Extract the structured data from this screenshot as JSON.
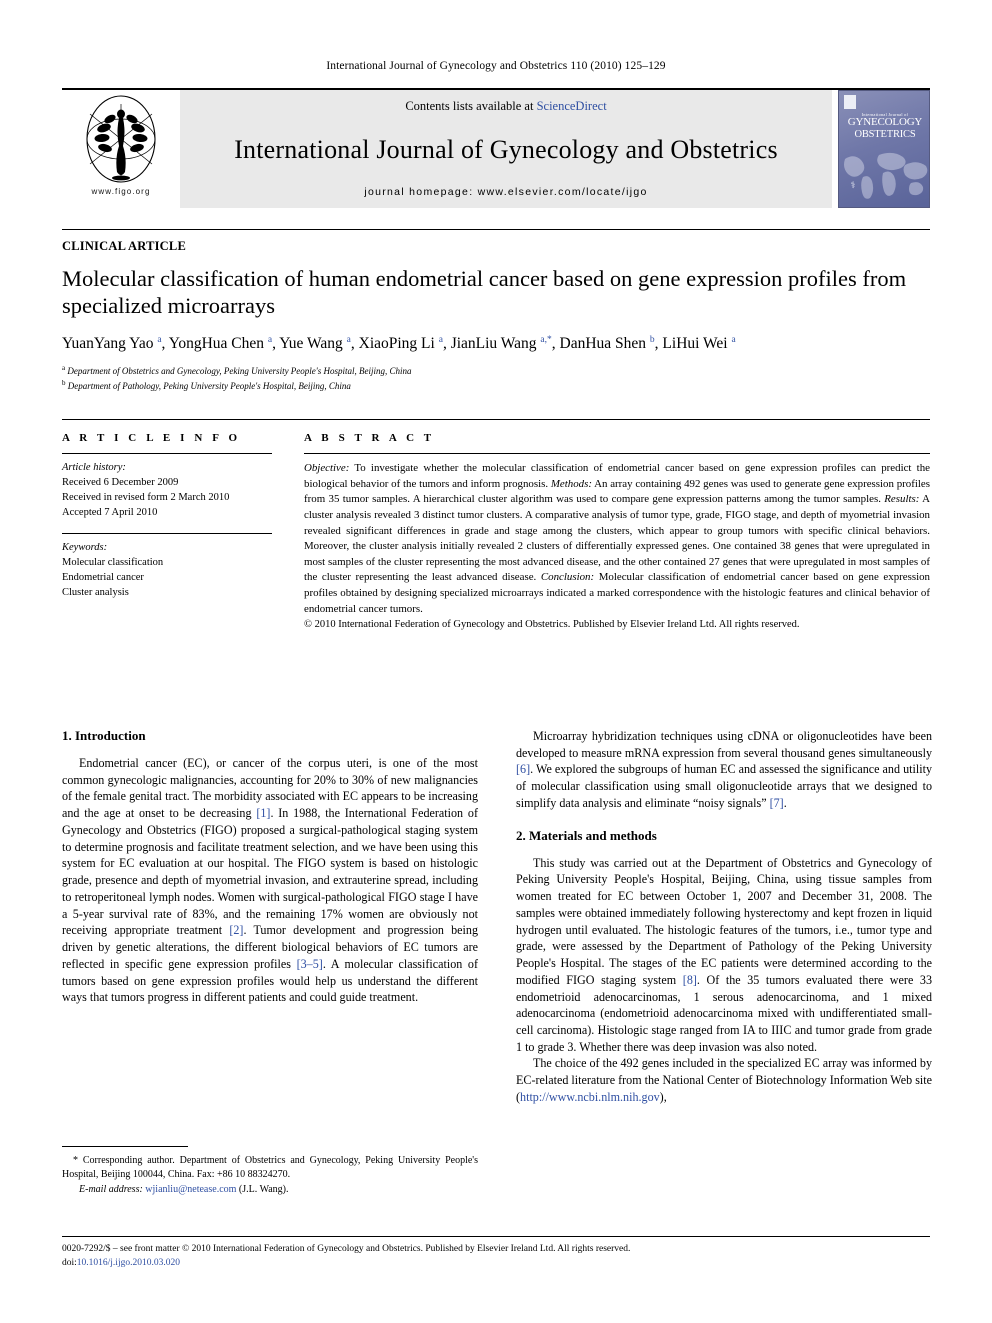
{
  "running_head": "International Journal of Gynecology and Obstetrics 110 (2010) 125–129",
  "masthead": {
    "figo_url": "www.figo.org",
    "contents_prefix": "Contents lists available at ",
    "contents_link": "ScienceDirect",
    "journal_title": "International Journal of Gynecology and Obstetrics",
    "homepage": "journal homepage: www.elsevier.com/locate/ijgo",
    "cover": {
      "line1": "International Journal of",
      "line2": "GYNECOLOGY",
      "line3": "OBSTETRICS"
    }
  },
  "article": {
    "type": "CLINICAL ARTICLE",
    "title": "Molecular classification of human endometrial cancer based on gene expression profiles from specialized microarrays",
    "authors": "YuanYang Yao a, YongHua Chen a, Yue Wang a, XiaoPing Li a, JianLiu Wang a,*, DanHua Shen b, LiHui Wei a",
    "affiliation_a": "Department of Obstetrics and Gynecology, Peking University People's Hospital, Beijing, China",
    "affiliation_b": "Department of Pathology, Peking University People's Hospital, Beijing, China"
  },
  "info": {
    "heading": "A R T I C L E    I N F O",
    "history_label": "Article history:",
    "history": [
      "Received 6 December 2009",
      "Received in revised form 2 March 2010",
      "Accepted 7 April 2010"
    ],
    "keywords_label": "Keywords:",
    "keywords": [
      "Molecular classification",
      "Endometrial cancer",
      "Cluster analysis"
    ]
  },
  "abstract": {
    "heading": "A B S T R A C T",
    "objective_label": "Objective:",
    "objective_text": " To investigate whether the molecular classification of endometrial cancer based on gene expression profiles can predict the biological behavior of the tumors and inform prognosis. ",
    "methods_label": "Methods:",
    "methods_text": " An array containing 492 genes was used to generate gene expression profiles from 35 tumor samples. A hierarchical cluster algorithm was used to compare gene expression patterns among the tumor samples. ",
    "results_label": "Results:",
    "results_text": " A cluster analysis revealed 3 distinct tumor clusters. A comparative analysis of tumor type, grade, FIGO stage, and depth of myometrial invasion revealed significant differences in grade and stage among the clusters, which appear to group tumors with specific clinical behaviors. Moreover, the cluster analysis initially revealed 2 clusters of differentially expressed genes. One contained 38 genes that were upregulated in most samples of the cluster representing the most advanced disease, and the other contained 27 genes that were upregulated in most samples of the cluster representing the least advanced disease. ",
    "conclusion_label": "Conclusion:",
    "conclusion_text": " Molecular classification of endometrial cancer based on gene expression profiles obtained by designing specialized microarrays indicated a marked correspondence with the histologic features and clinical behavior of endometrial cancer tumors.",
    "copyright": "© 2010 International Federation of Gynecology and Obstetrics. Published by Elsevier Ireland Ltd. All rights reserved."
  },
  "body": {
    "intro_heading": "1. Introduction",
    "intro_p1_a": "Endometrial cancer (EC), or cancer of the corpus uteri, is one of the most common gynecologic malignancies, accounting for 20% to 30% of new malignancies of the female genital tract. The morbidity associated with EC appears to be increasing and the age at onset to be decreasing ",
    "intro_p1_ref1": "[1]",
    "intro_p1_b": ". In 1988, the International Federation of Gynecology and Obstetrics (FIGO) proposed a surgical-pathological staging system to determine prognosis and facilitate treatment selection, and we have been using this system for EC evaluation at our hospital. The FIGO system is based on histologic grade, presence and depth of myometrial invasion, and extrauterine spread, including to retroperitoneal lymph nodes. Women with surgical-pathological FIGO stage I have a 5-year survival rate of 83%, and the remaining 17% women are obviously not receiving appropriate treatment ",
    "intro_p1_ref2": "[2]",
    "intro_p1_c": ". Tumor development and progression being driven by genetic alterations, the different biological behaviors of EC tumors are reflected in specific gene expression profiles ",
    "intro_p1_ref3": "[3–5]",
    "intro_p1_d": ". A molecular classification of tumors based on gene expression profiles would help us understand the different ways that tumors progress in different patients and could guide treatment.",
    "right_p1_a": "Microarray hybridization techniques using cDNA or oligonucleotides have been developed to measure mRNA expression from several thousand genes simultaneously ",
    "right_p1_ref6": "[6]",
    "right_p1_b": ". We explored the subgroups of human EC and assessed the significance and utility of molecular classification using small oligonucleotide arrays that we designed to simplify data analysis and eliminate “noisy signals” ",
    "right_p1_ref7": "[7]",
    "right_p1_c": ".",
    "methods_heading": "2. Materials and methods",
    "methods_p1_a": "This study was carried out at the Department of Obstetrics and Gynecology of Peking University People's Hospital, Beijing, China, using tissue samples from women treated for EC between October 1, 2007 and December 31, 2008. The samples were obtained immediately following hysterectomy and kept frozen in liquid hydrogen until evaluated. The histologic features of the tumors, i.e., tumor type and grade, were assessed by the Department of Pathology of the Peking University People's Hospital. The stages of the EC patients were determined according to the modified FIGO staging system ",
    "methods_p1_ref8": "[8]",
    "methods_p1_b": ". Of the 35 tumors evaluated there were 33 endometrioid adenocarcinomas, 1 serous adenocarcinoma, and 1 mixed adenocarcinoma (endometrioid adenocarcinoma mixed with undifferentiated small-cell carcinoma). Histologic stage ranged from IA to IIIC and tumor grade from grade 1 to grade 3. Whether there was deep invasion was also noted.",
    "methods_p2_a": "The choice of the 492 genes included in the specialized EC array was informed by EC-related literature from the National Center of Biotechnology Information Web site (",
    "methods_p2_link": "http://www.ncbi.nlm.nih.gov",
    "methods_p2_b": "),"
  },
  "footnote": {
    "star": "*",
    "text": " Corresponding author. Department of Obstetrics and Gynecology, Peking University People's Hospital, Beijing 100044, China. Fax: +86 10 88324270.",
    "email_label": "E-mail address:",
    "email": "wjianliu@netease.com",
    "email_owner": "(J.L. Wang)."
  },
  "publisher_footer": {
    "line1": "0020-7292/$ – see front matter © 2010 International Federation of Gynecology and Obstetrics. Published by Elsevier Ireland Ltd. All rights reserved.",
    "doi_label": "doi:",
    "doi": "10.1016/j.ijgo.2010.03.020"
  },
  "colors": {
    "link": "#2f4fa2",
    "masthead_bg": "#e9e9e9",
    "cover_blue": "#6f77a8"
  }
}
